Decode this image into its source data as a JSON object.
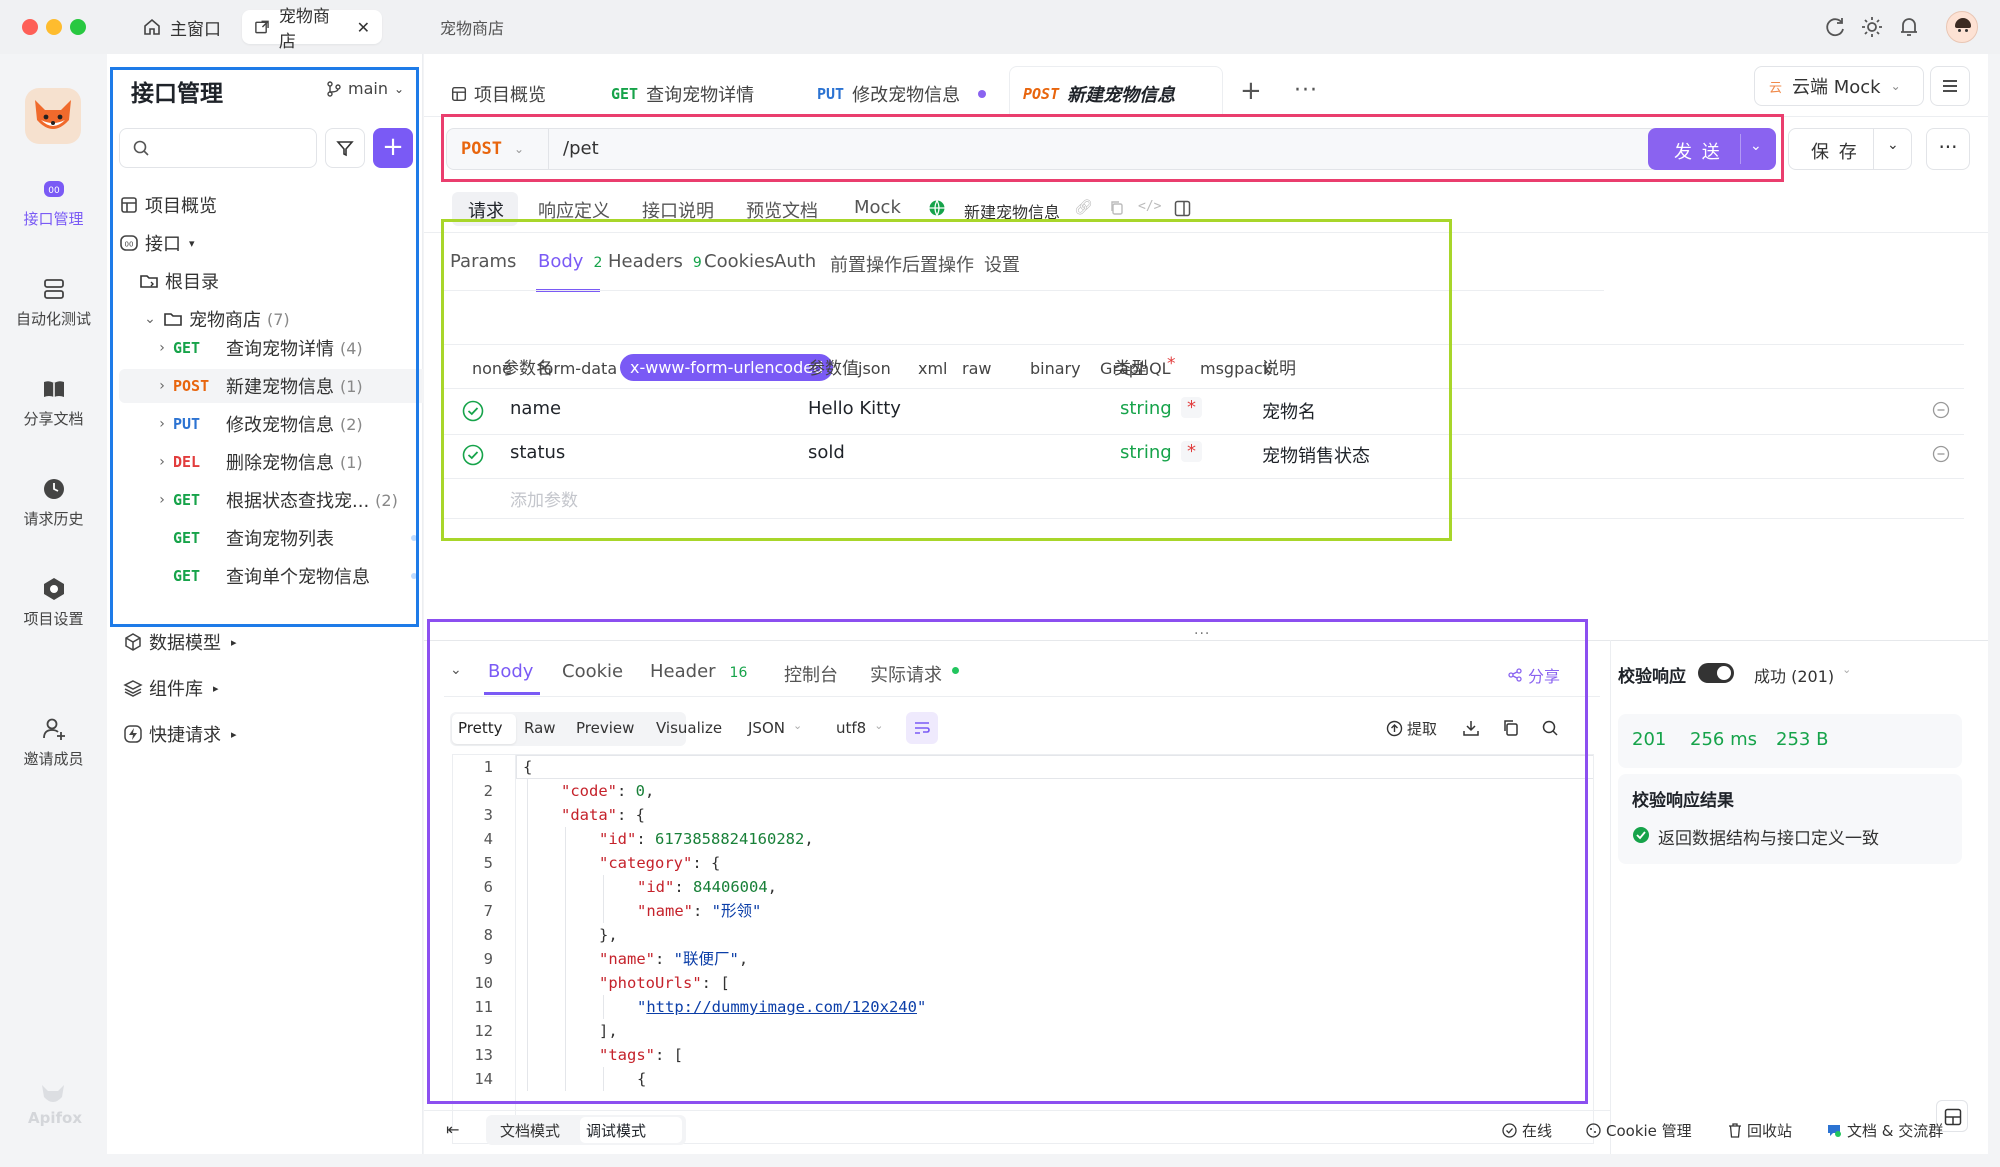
{
  "titlebar": {
    "home_tab": "主窗口",
    "project_tab": "宠物商店",
    "window_title": "宠物商店"
  },
  "rail": {
    "items": [
      {
        "label": "接口管理"
      },
      {
        "label": "自动化测试"
      },
      {
        "label": "分享文档"
      },
      {
        "label": "请求历史"
      },
      {
        "label": "项目设置"
      },
      {
        "label": "邀请成员"
      }
    ],
    "brand": "Apifox",
    "accent": "#7a5af5"
  },
  "sidebar": {
    "title": "接口管理",
    "branch": "main",
    "overview": "项目概览",
    "api_group": "接口",
    "root": "根目录",
    "folder": {
      "name": "宠物商店",
      "count": "(7)"
    },
    "apis": [
      {
        "method": "GET",
        "name": "查询宠物详情",
        "count": "(4)"
      },
      {
        "method": "POST",
        "name": "新建宠物信息",
        "count": "(1)"
      },
      {
        "method": "PUT",
        "name": "修改宠物信息",
        "count": "(2)"
      },
      {
        "method": "DEL",
        "name": "删除宠物信息",
        "count": "(1)"
      },
      {
        "method": "GET",
        "name": "根据状态查找宠...",
        "count": "(2)"
      },
      {
        "method": "GET",
        "name": "查询宠物列表",
        "count": ""
      },
      {
        "method": "GET",
        "name": "查询单个宠物信息",
        "count": ""
      }
    ],
    "data_model": "数据模型",
    "components": "组件库",
    "quick_request": "快捷请求"
  },
  "tabs": [
    {
      "method": "",
      "label": "项目概览"
    },
    {
      "method": "GET",
      "label": "查询宠物详情"
    },
    {
      "method": "PUT",
      "label": "修改宠物信息"
    },
    {
      "method": "POST",
      "label": "新建宠物信息"
    }
  ],
  "env": {
    "icon_text": "云",
    "label": "云端 Mock"
  },
  "request": {
    "method": "POST",
    "url": "/pet",
    "send": "发 送",
    "save": "保 存"
  },
  "req_tabs": [
    "请求",
    "响应定义",
    "接口说明",
    "预览文档",
    "Mock"
  ],
  "api_name": "新建宠物信息",
  "param_tabs": [
    {
      "label": "Params",
      "badge": ""
    },
    {
      "label": "Body",
      "badge": "2"
    },
    {
      "label": "Headers",
      "badge": "9"
    },
    {
      "label": "Cookies",
      "badge": ""
    },
    {
      "label": "Auth",
      "badge": ""
    },
    {
      "label": "前置操作",
      "badge": ""
    },
    {
      "label": "后置操作",
      "badge": ""
    },
    {
      "label": "设置",
      "badge": ""
    }
  ],
  "body_types": [
    "none",
    "form-data",
    "x-www-form-urlencoded",
    "json",
    "xml",
    "raw",
    "binary",
    "GraphQL",
    "msgpack"
  ],
  "params_table": {
    "headers": {
      "name": "参数名",
      "value": "参数值",
      "type": "类型",
      "required": "*",
      "desc": "说明"
    },
    "rows": [
      {
        "name": "name",
        "value": "Hello Kitty",
        "type": "string",
        "required": "*",
        "desc": "宠物名"
      },
      {
        "name": "status",
        "value": "sold",
        "type": "string",
        "required": "*",
        "desc": "宠物销售状态"
      }
    ],
    "add_placeholder": "添加参数"
  },
  "response": {
    "tabs": [
      {
        "label": "Body",
        "badge": ""
      },
      {
        "label": "Cookie",
        "badge": ""
      },
      {
        "label": "Header",
        "badge": "16"
      },
      {
        "label": "控制台",
        "badge": ""
      },
      {
        "label": "实际请求",
        "badge": ""
      }
    ],
    "share": "分享",
    "views": [
      "Pretty",
      "Raw",
      "Preview",
      "Visualize"
    ],
    "format": "JSON",
    "encoding": "utf8",
    "extract": "提取",
    "code_lines": [
      {
        "n": "1",
        "indent": 0,
        "parts": [
          [
            "p",
            "{"
          ]
        ]
      },
      {
        "n": "2",
        "indent": 1,
        "parts": [
          [
            "k",
            "\"code\""
          ],
          [
            "p",
            ": "
          ],
          [
            "n",
            "0"
          ],
          [
            "p",
            ","
          ]
        ]
      },
      {
        "n": "3",
        "indent": 1,
        "parts": [
          [
            "k",
            "\"data\""
          ],
          [
            "p",
            ": {"
          ]
        ]
      },
      {
        "n": "4",
        "indent": 2,
        "parts": [
          [
            "k",
            "\"id\""
          ],
          [
            "p",
            ": "
          ],
          [
            "n",
            "6173858824160282"
          ],
          [
            "p",
            ","
          ]
        ]
      },
      {
        "n": "5",
        "indent": 2,
        "parts": [
          [
            "k",
            "\"category\""
          ],
          [
            "p",
            ": {"
          ]
        ]
      },
      {
        "n": "6",
        "indent": 3,
        "parts": [
          [
            "k",
            "\"id\""
          ],
          [
            "p",
            ": "
          ],
          [
            "n",
            "84406004"
          ],
          [
            "p",
            ","
          ]
        ]
      },
      {
        "n": "7",
        "indent": 3,
        "parts": [
          [
            "k",
            "\"name\""
          ],
          [
            "p",
            ": "
          ],
          [
            "s",
            "\"形领\""
          ]
        ]
      },
      {
        "n": "8",
        "indent": 2,
        "parts": [
          [
            "p",
            "},"
          ]
        ]
      },
      {
        "n": "9",
        "indent": 2,
        "parts": [
          [
            "k",
            "\"name\""
          ],
          [
            "p",
            ": "
          ],
          [
            "s",
            "\"联便厂\""
          ],
          [
            "p",
            ","
          ]
        ]
      },
      {
        "n": "10",
        "indent": 2,
        "parts": [
          [
            "k",
            "\"photoUrls\""
          ],
          [
            "p",
            ": ["
          ]
        ]
      },
      {
        "n": "11",
        "indent": 3,
        "parts": [
          [
            "s",
            "\""
          ],
          [
            "u",
            "http://dummyimage.com/120x240"
          ],
          [
            "s",
            "\""
          ]
        ]
      },
      {
        "n": "12",
        "indent": 2,
        "parts": [
          [
            "p",
            "],"
          ]
        ]
      },
      {
        "n": "13",
        "indent": 2,
        "parts": [
          [
            "k",
            "\"tags\""
          ],
          [
            "p",
            ": ["
          ]
        ]
      },
      {
        "n": "14",
        "indent": 3,
        "parts": [
          [
            "p",
            "{"
          ]
        ]
      }
    ]
  },
  "validation": {
    "label": "校验响应",
    "status_select": "成功 (201)",
    "status_code": "201",
    "time": "256 ms",
    "size": "253 B",
    "result_title": "校验响应结果",
    "result_text": "返回数据结构与接口定义一致"
  },
  "footer": {
    "doc_mode": "文档模式",
    "debug_mode": "调试模式",
    "online": "在线",
    "cookie": "Cookie 管理",
    "trash": "回收站",
    "community": "文档 & 交流群"
  },
  "colors": {
    "get": "#17a34a",
    "post": "#e8650d",
    "put": "#2c73d2",
    "del": "#e23d3d",
    "frame_blue": "#1e7be8",
    "frame_pink": "#ea3e6e",
    "frame_green": "#a8d62a",
    "frame_purple": "#8c4ff0"
  }
}
